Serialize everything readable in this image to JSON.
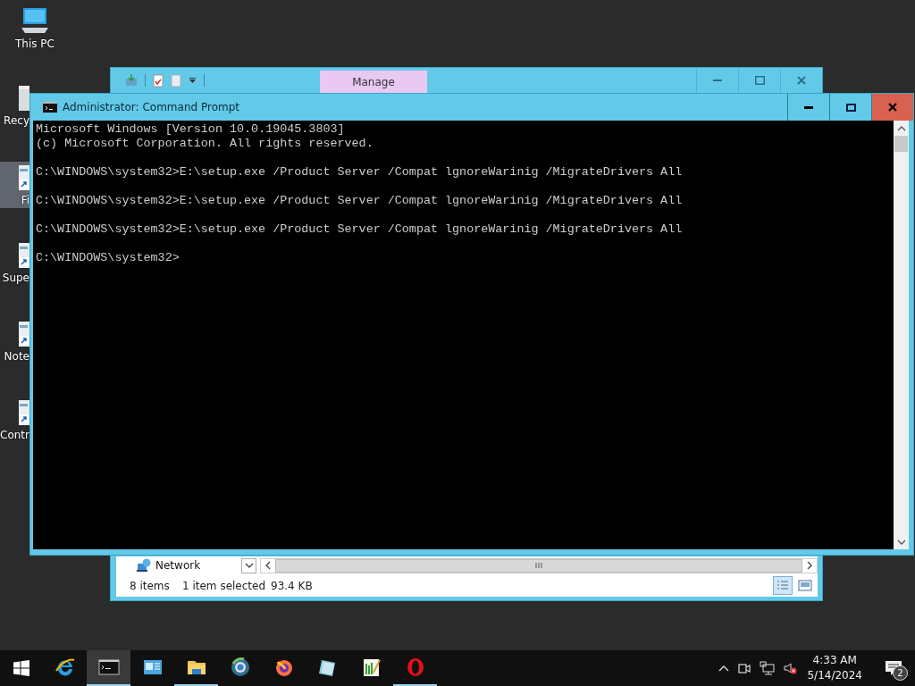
{
  "desktop_icons": [
    {
      "label": "This PC",
      "kind": "computer",
      "covered": false,
      "selected": false
    },
    {
      "label": "Recy",
      "kind": "recycle",
      "covered": true,
      "selected": false
    },
    {
      "label": "Fi",
      "kind": "shortcut",
      "covered": true,
      "selected": true
    },
    {
      "label": "Supe",
      "kind": "shortcut",
      "covered": true,
      "selected": false
    },
    {
      "label": "Note",
      "kind": "shortcut",
      "covered": true,
      "selected": false
    },
    {
      "label": "Contr",
      "kind": "shortcut",
      "covered": true,
      "selected": false
    }
  ],
  "explorer_window": {
    "tab": "Manage",
    "nav_item": "Network",
    "status": [
      "8 items",
      "1 item selected",
      "93.4 KB"
    ],
    "views": [
      {
        "kind": "details",
        "selected": true
      },
      {
        "kind": "preview",
        "selected": false
      }
    ]
  },
  "console_window": {
    "title": "Administrator: Command Prompt",
    "blocks": [
      [
        "Microsoft Windows [Version 10.0.19045.3803]",
        "(c) Microsoft Corporation. All rights reserved."
      ],
      [
        "C:\\WINDOWS\\system32>E:\\setup.exe /Product Server /Compat lgnoreWarinig /MigrateDrivers All"
      ],
      [
        "C:\\WINDOWS\\system32>E:\\setup.exe /Product Server /Compat lgnoreWarinig /MigrateDrivers All"
      ],
      [
        "C:\\WINDOWS\\system32>E:\\setup.exe /Product Server /Compat lgnoreWarinig /MigrateDrivers All"
      ],
      [
        "C:\\WINDOWS\\system32>"
      ]
    ]
  },
  "taskbar": {
    "apps": [
      {
        "kind": "browser-e",
        "running": false,
        "selected": false
      },
      {
        "kind": "console",
        "running": true,
        "selected": true
      },
      {
        "kind": "panel",
        "running": false,
        "selected": false
      },
      {
        "kind": "folder",
        "running": true,
        "selected": false
      },
      {
        "kind": "globe",
        "running": false,
        "selected": false
      },
      {
        "kind": "fox",
        "running": false,
        "selected": false
      },
      {
        "kind": "notebook",
        "running": false,
        "selected": false
      },
      {
        "kind": "notepad",
        "running": false,
        "selected": false
      },
      {
        "kind": "ring",
        "running": true,
        "selected": false
      }
    ],
    "time": "4:33 AM",
    "date": "5/14/2024",
    "notification_count": "2"
  }
}
